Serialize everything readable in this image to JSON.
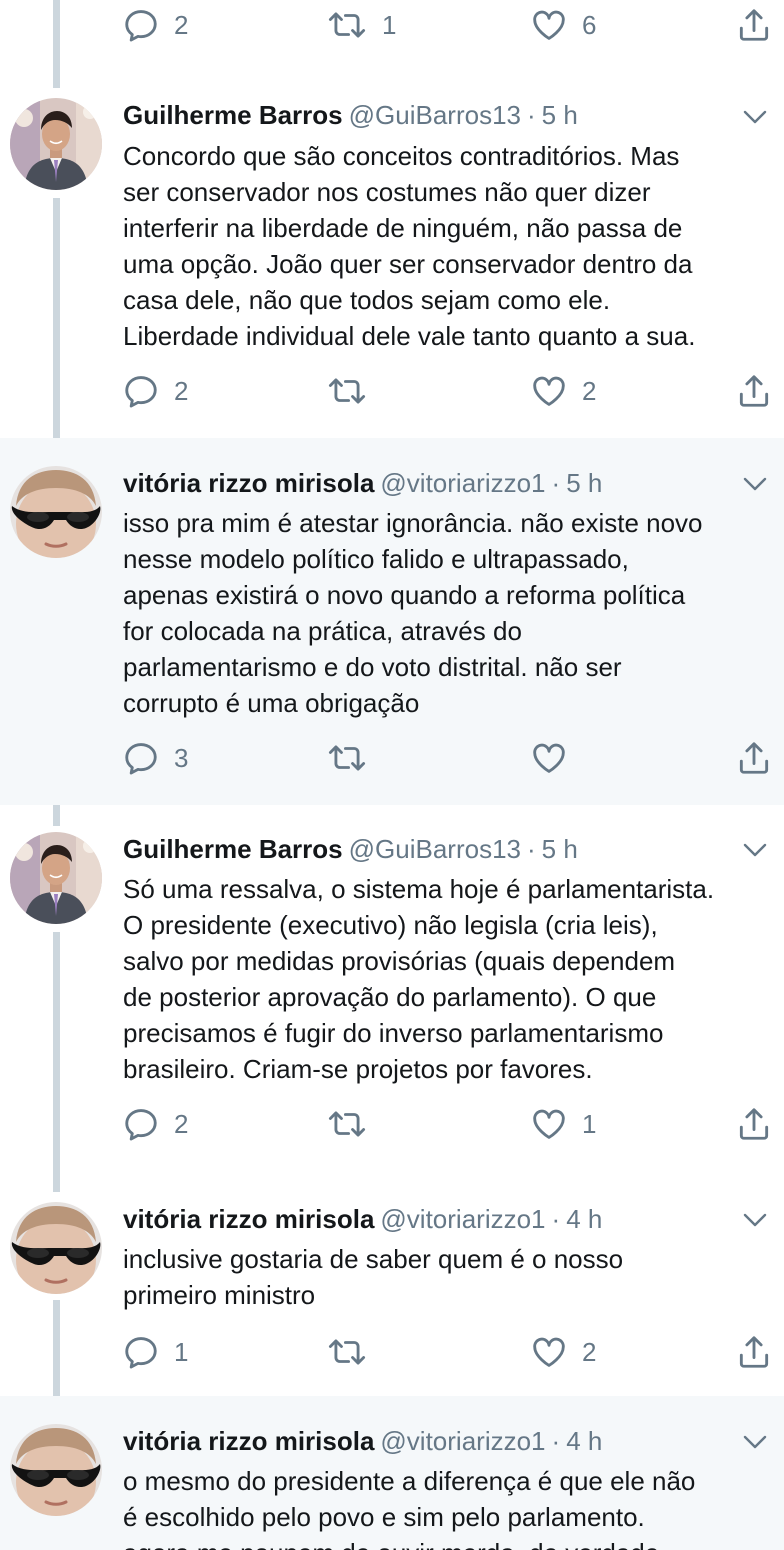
{
  "colors": {
    "text": "#14171a",
    "secondary": "#657786",
    "thread_line": "#ccd6dd",
    "highlight_bg": "#f5f8fa"
  },
  "icons": {
    "reply": "reply-icon",
    "retweet": "retweet-icon",
    "like": "heart-icon",
    "share": "share-icon",
    "menu": "chevron-down-icon"
  },
  "top_actions": {
    "replies": "2",
    "retweets": "1",
    "likes": "6"
  },
  "tweets": [
    {
      "name": "Guilherme Barros",
      "handle": "@GuiBarros13",
      "separator": "·",
      "time": "5 h",
      "text": "Concordo que são conceitos contraditórios. Mas\nser conservador nos costumes não quer dizer\ninterferir na liberdade de ninguém, não passa de\numa opção. João quer ser conservador dentro da\ncasa dele, não que todos sejam como ele.\nLiberdade individual dele vale tanto quanto a sua.",
      "replies": "2",
      "retweets": "",
      "likes": "2"
    },
    {
      "name": "vitória rizzo mirisola",
      "handle": "@vitoriarizzo1",
      "separator": "·",
      "time": "5 h",
      "text": "isso pra mim é atestar ignorância. não existe novo\nnesse modelo político falido e ultrapassado,\napenas existirá o novo quando a reforma política\nfor colocada na prática, através do\nparlamentarismo e do voto distrital. não ser\ncorrupto é uma obrigação",
      "replies": "3",
      "retweets": "",
      "likes": ""
    },
    {
      "name": "Guilherme Barros",
      "handle": "@GuiBarros13",
      "separator": "·",
      "time": "5 h",
      "text": "Só uma ressalva, o sistema hoje é parlamentarista.\nO presidente (executivo) não legisla (cria leis),\nsalvo por medidas provisórias (quais dependem\nde posterior aprovação do parlamento). O que\nprecisamos é fugir do inverso parlamentarismo\nbrasileiro. Criam-se projetos por favores.",
      "replies": "2",
      "retweets": "",
      "likes": "1"
    },
    {
      "name": "vitória rizzo mirisola",
      "handle": "@vitoriarizzo1",
      "separator": "·",
      "time": "4 h",
      "text": "inclusive gostaria de saber quem é o nosso\nprimeiro ministro",
      "replies": "1",
      "retweets": "",
      "likes": "2"
    },
    {
      "name": "vitória rizzo mirisola",
      "handle": "@vitoriarizzo1",
      "separator": "·",
      "time": "4 h",
      "text": "o mesmo do presidente a diferença é que ele não\né escolhido pelo povo e sim pelo parlamento.\nagora me poupem de ouvir merda, de verdade"
    }
  ]
}
